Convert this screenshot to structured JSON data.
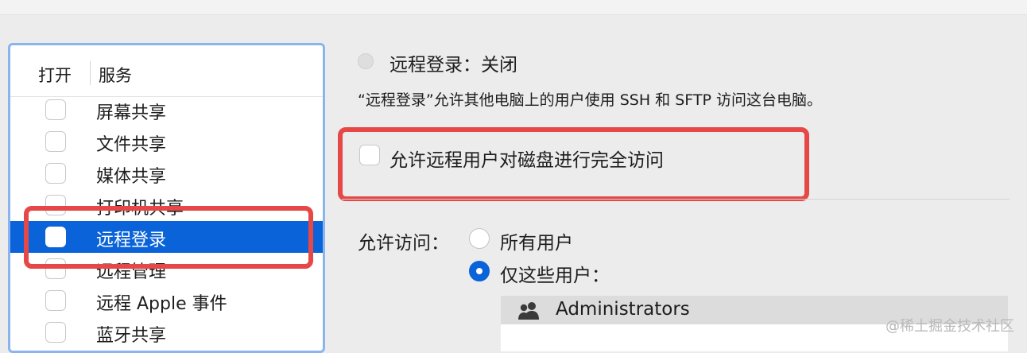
{
  "list": {
    "header_open": "打开",
    "header_service": "服务",
    "services": [
      {
        "label": "屏幕共享",
        "checked": false
      },
      {
        "label": "文件共享",
        "checked": false
      },
      {
        "label": "媒体共享",
        "checked": false
      },
      {
        "label": "打印机共享",
        "checked": false
      },
      {
        "label": "远程登录",
        "checked": false,
        "selected": true
      },
      {
        "label": "远程管理",
        "checked": false
      },
      {
        "label": "远程 Apple 事件",
        "checked": false
      },
      {
        "label": "蓝牙共享",
        "checked": false
      }
    ]
  },
  "detail": {
    "status": "远程登录：关闭",
    "description": "“远程登录”允许其他电脑上的用户使用 SSH 和 SFTP 访问这台电脑。",
    "full_disk_access_label": "允许远程用户对磁盘进行完全访问",
    "full_disk_access_checked": false,
    "allow_access_label": "允许访问：",
    "option_all_users": "所有用户",
    "option_only_these": "仅这些用户：",
    "selected_option": "仅这些用户：",
    "users_list": [
      "Administrators"
    ]
  },
  "watermark": "@稀土掘金技术社区",
  "colors": {
    "selection": "#0a63d8",
    "annotation": "#e64848",
    "focus_ring": "#8ab4f0"
  },
  "icons": {
    "users": "group-icon"
  }
}
